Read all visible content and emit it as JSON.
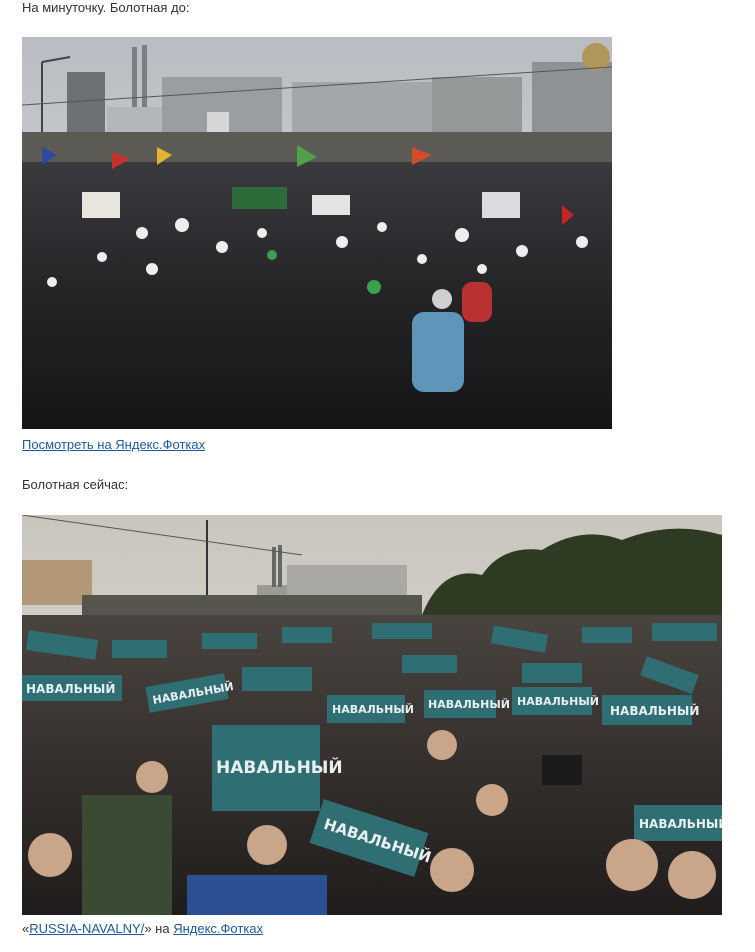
{
  "post": {
    "intro_text": "На минуточку. Болотная до:",
    "photo1_link_text": "Посмотреть на Яндекс.Фотках",
    "second_heading": "Болотная сейчас:",
    "caption": {
      "open_quote": "«",
      "album_link_text": "RUSSIA-NAVALNY/",
      "close_quote_and_on": "» на ",
      "service_link_text": "Яндекс.Фотках"
    }
  },
  "photo1": {
    "description_type": "protest-crowd-photo",
    "colors": {
      "sky": "#c9ccd0",
      "crowd_dark": "#1c1b1d",
      "buildings": "#8e9196"
    }
  },
  "photo2": {
    "description_type": "protest-crowd-with-signs-photo",
    "sign_text": "НАВАЛЬНЫЙ",
    "colors": {
      "sky": "#d9d6cf",
      "sign": "#2f6f73",
      "trees": "#2f3a23",
      "crowd_dark": "#2a2624"
    }
  }
}
